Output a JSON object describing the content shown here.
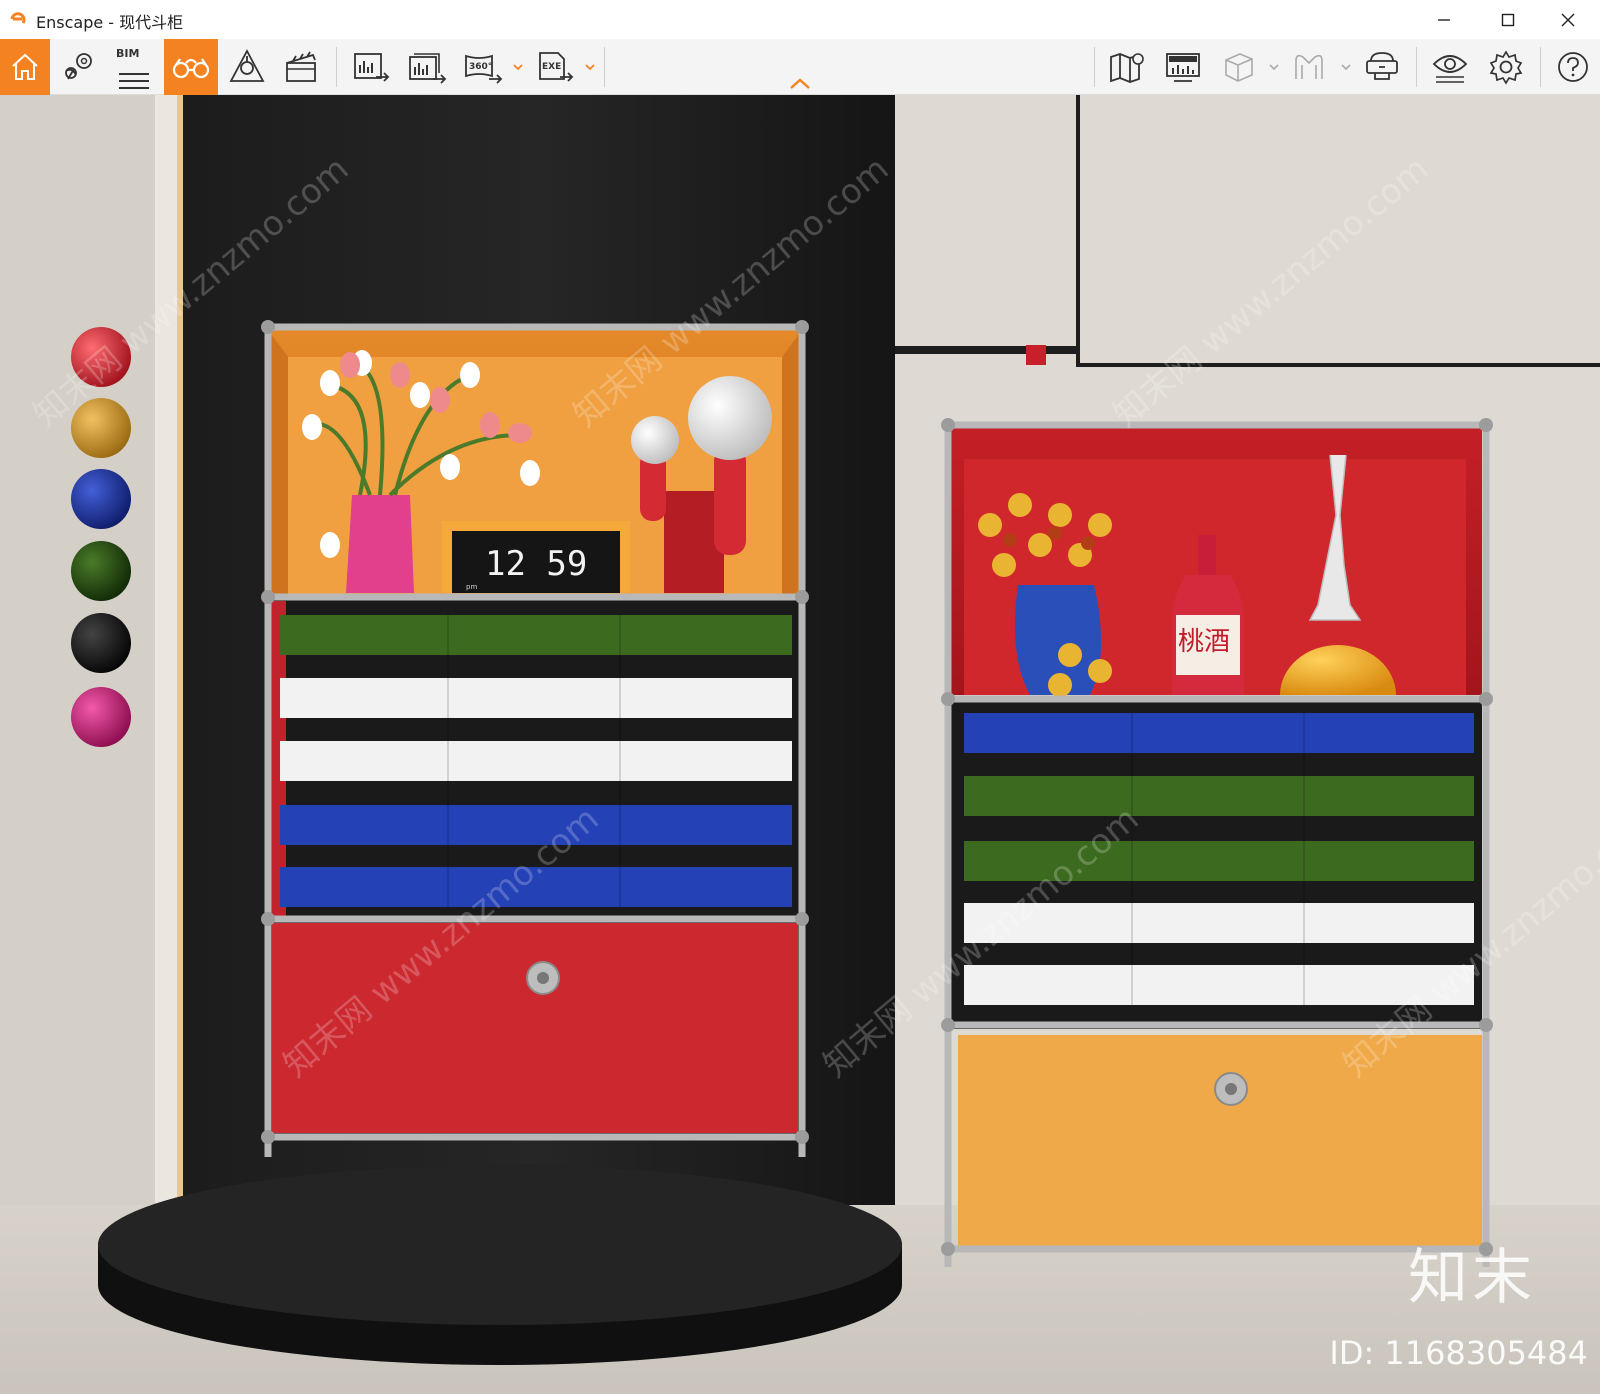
{
  "window": {
    "title": "Enscape - 现代斗柜"
  },
  "toolbar": {
    "items": [
      {
        "icon": "home-icon"
      },
      {
        "icon": "location-pin-icon"
      },
      {
        "icon": "bim-list-icon",
        "label": "BIM"
      },
      {
        "icon": "binoculars-icon",
        "active": true
      },
      {
        "icon": "asset-library-icon"
      },
      {
        "icon": "clapperboard-icon"
      },
      {
        "icon": "screenshot-export-icon"
      },
      {
        "icon": "batch-export-icon"
      },
      {
        "icon": "panorama-export-icon",
        "label": "360°"
      },
      {
        "icon": "exe-export-icon",
        "label": "EXE"
      },
      {
        "icon": "map-icon"
      },
      {
        "icon": "monitor-chart-icon"
      },
      {
        "icon": "cube-icon"
      },
      {
        "icon": "vr-icon"
      },
      {
        "icon": "vr-headset-icon"
      },
      {
        "icon": "eye-settings-icon"
      },
      {
        "icon": "gear-icon"
      },
      {
        "icon": "help-icon"
      }
    ],
    "accent": "#f58220"
  },
  "viewport": {
    "clock": {
      "time": "12 59",
      "ampm": "pm"
    },
    "bottle_label": "桃酒",
    "watermark_text": "知末网 www.znzmo.com",
    "brand_mark": "知末",
    "image_id": "ID: 1168305484"
  }
}
